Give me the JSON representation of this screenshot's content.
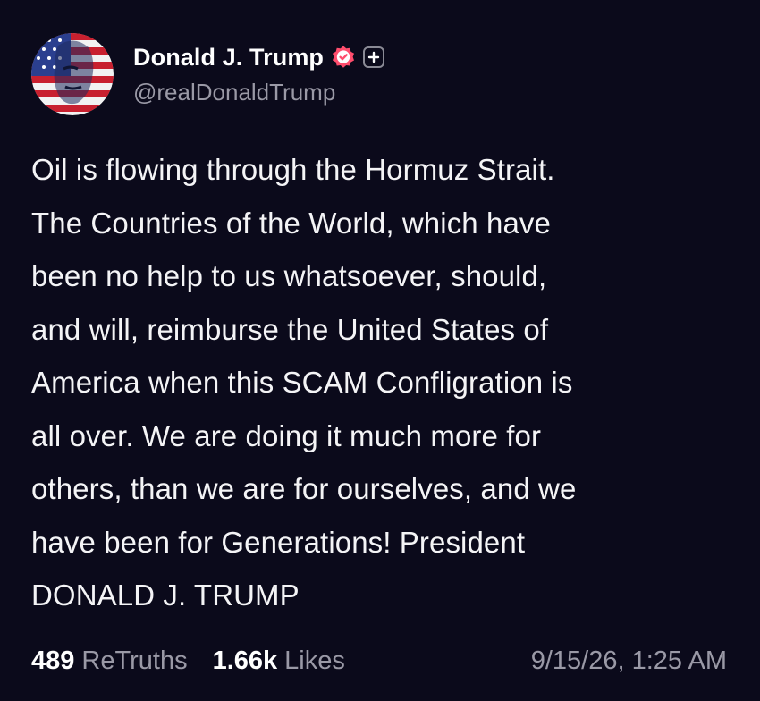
{
  "author": {
    "display_name": "Donald J. Trump",
    "handle": "@realDonaldTrump",
    "verified_icon": "verified-badge-icon",
    "follow_icon": "plus-icon",
    "avatar_icon": "avatar-american-flag-portrait",
    "badge_color": "#ff4d6d"
  },
  "post": {
    "text": "Oil is flowing through the Hormuz Strait.\nThe Countries of the World, which have\nbeen no help to us whatsoever, should,\nand will, reimburse the United States of\nAmerica when this SCAM Confligration is\nall over. We are doing it much more for\nothers, than we are for ourselves, and we\nhave been for Generations! President\nDONALD J. TRUMP"
  },
  "stats": {
    "retruths_count": "489",
    "retruths_label": "ReTruths",
    "likes_count": "1.66k",
    "likes_label": "Likes",
    "timestamp": "9/15/26, 1:25 AM"
  },
  "colors": {
    "background": "#0b0a1b",
    "text_primary": "#ffffff",
    "text_secondary": "#9a99a6"
  }
}
